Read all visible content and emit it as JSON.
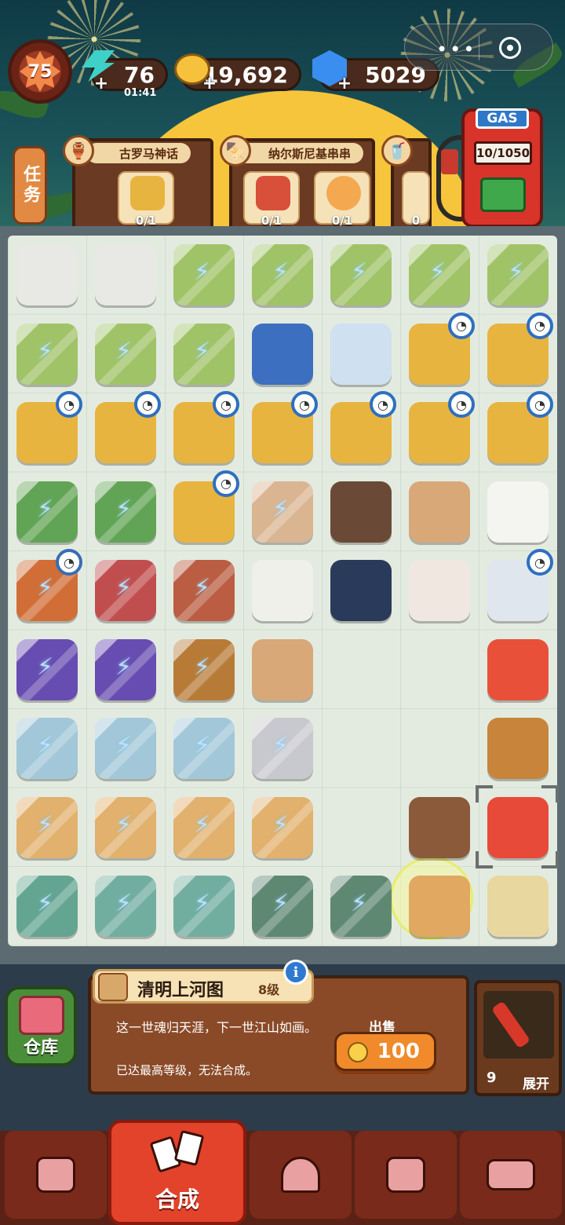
{
  "hud": {
    "level": "75",
    "energy": "76",
    "energy_timer": "01:41",
    "coins": "19,692",
    "gems": "5029"
  },
  "quests": {
    "tab_label": "任务",
    "cards": [
      {
        "title": "古罗马神话",
        "slots": [
          {
            "count": "0/1"
          }
        ]
      },
      {
        "title": "纳尔斯尼基串串",
        "slots": [
          {
            "count": "0/1"
          },
          {
            "count": "0/1"
          }
        ]
      },
      {
        "title": "",
        "slots": [
          {
            "count": "0"
          }
        ]
      }
    ]
  },
  "gas_station": {
    "label": "GAS",
    "fuel": "10/1050"
  },
  "board": {
    "rows": [
      [
        {
          "icon": "printer-icon",
          "color": "#e8e8e4",
          "locked": false
        },
        {
          "icon": "printer-icon",
          "color": "#e8e8e4",
          "locked": false
        },
        {
          "icon": "bamboo-pot-icon",
          "color": "#9cc65a",
          "locked": true
        },
        {
          "icon": "bamboo-pot-icon",
          "color": "#9cc65a",
          "locked": true
        },
        {
          "icon": "bamboo-pot-icon",
          "color": "#9cc65a",
          "locked": true
        },
        {
          "icon": "bamboo-pot-icon",
          "color": "#9cc65a",
          "locked": true
        },
        {
          "icon": "bamboo-pot-icon",
          "color": "#9cc65a",
          "locked": true
        }
      ],
      [
        {
          "icon": "bamboo-pot-icon",
          "color": "#9cc65a",
          "locked": true
        },
        {
          "icon": "bamboo-pot-icon",
          "color": "#9cc65a",
          "locked": true
        },
        {
          "icon": "bamboo-pot-icon",
          "color": "#9cc65a",
          "locked": true
        },
        {
          "icon": "book-icon",
          "color": "#3c6fc0",
          "locked": false
        },
        {
          "icon": "notebook-icon",
          "color": "#cfe0f0",
          "locked": false
        },
        {
          "icon": "drone-box-icon",
          "color": "#e8b440",
          "locked": false,
          "timer": true
        },
        {
          "icon": "drone-box-icon",
          "color": "#e8b440",
          "locked": false,
          "timer": true
        }
      ],
      [
        {
          "icon": "drone-box-icon",
          "color": "#e8b440",
          "locked": false,
          "timer": true
        },
        {
          "icon": "drone-box-icon",
          "color": "#e8b440",
          "locked": false,
          "timer": true
        },
        {
          "icon": "drone-box-icon",
          "color": "#e8b440",
          "locked": false,
          "timer": true
        },
        {
          "icon": "drone-box-icon",
          "color": "#e8b440",
          "locked": false,
          "timer": true
        },
        {
          "icon": "drone-box-icon",
          "color": "#e8b440",
          "locked": false,
          "timer": true
        },
        {
          "icon": "drone-box-icon",
          "color": "#e8b440",
          "locked": false,
          "timer": true
        },
        {
          "icon": "drone-box-icon",
          "color": "#e8b440",
          "locked": false,
          "timer": true
        }
      ],
      [
        {
          "icon": "tree-icon",
          "color": "#5aa84a",
          "locked": true
        },
        {
          "icon": "tree-icon",
          "color": "#5aa84a",
          "locked": true
        },
        {
          "icon": "drone-box-icon",
          "color": "#e8b440",
          "locked": false,
          "timer": true
        },
        {
          "icon": "cart-icon",
          "color": "#e0b48a",
          "locked": true
        },
        {
          "icon": "tray-icon",
          "color": "#6a4a36",
          "locked": false
        },
        {
          "icon": "wood-piece-icon",
          "color": "#d8a878",
          "locked": false
        },
        {
          "icon": "sugar-cubes-icon",
          "color": "#f4f4f0",
          "locked": false
        }
      ],
      [
        {
          "icon": "peacock-feather-icon",
          "color": "#e06a2a",
          "locked": true,
          "timer": true
        },
        {
          "icon": "rose-vase-icon",
          "color": "#d04a4a",
          "locked": true
        },
        {
          "icon": "gift-bag-icon",
          "color": "#c85a3a",
          "locked": true
        },
        {
          "icon": "calendar-icon",
          "color": "#f0f0ea",
          "locked": false
        },
        {
          "icon": "ink-bottle-icon",
          "color": "#2a3a5a",
          "locked": false
        },
        {
          "icon": "color-ink-box-icon",
          "color": "#f0e8e0",
          "locked": false
        },
        {
          "icon": "ink-jar-icon",
          "color": "#e0e6ee",
          "locked": false,
          "timer": true
        }
      ],
      [
        {
          "icon": "wizard-hat-icon",
          "color": "#6a4ac0",
          "locked": true
        },
        {
          "icon": "wizard-hat-icon",
          "color": "#6a4ac0",
          "locked": true
        },
        {
          "icon": "brass-machine-icon",
          "color": "#c07a2a",
          "locked": true
        },
        {
          "icon": "wood-piece-icon",
          "color": "#d8a878",
          "locked": false
        },
        {
          "icon": "",
          "color": "",
          "locked": false
        },
        {
          "icon": "",
          "color": "",
          "locked": false
        },
        {
          "icon": "triangle-candy-icon",
          "color": "#e8503a",
          "locked": false
        }
      ],
      [
        {
          "icon": "locker-icon",
          "color": "#9cc8dc",
          "locked": true
        },
        {
          "icon": "cabinet-icon",
          "color": "#9cc8dc",
          "locked": true
        },
        {
          "icon": "cabinet-icon",
          "color": "#9cc8dc",
          "locked": true
        },
        {
          "icon": "safe-icon",
          "color": "#c8c8d0",
          "locked": true
        },
        {
          "icon": "",
          "color": "",
          "locked": false
        },
        {
          "icon": "",
          "color": "",
          "locked": false
        },
        {
          "icon": "bubble-tea-icon",
          "color": "#c8843a",
          "locked": false
        }
      ],
      [
        {
          "icon": "frame-icon",
          "color": "#e8b060",
          "locked": true
        },
        {
          "icon": "shelf-cart-icon",
          "color": "#e8b060",
          "locked": true
        },
        {
          "icon": "shelf-cart-icon",
          "color": "#e8b060",
          "locked": true
        },
        {
          "icon": "bottle-shelf-icon",
          "color": "#e8b060",
          "locked": true
        },
        {
          "icon": "",
          "color": "",
          "locked": false
        },
        {
          "icon": "bubble-tea-icon",
          "color": "#8a5a3a",
          "locked": false
        },
        {
          "icon": "scroll-icon",
          "color": "#e84a3a",
          "locked": false,
          "focus": true
        }
      ],
      [
        {
          "icon": "hotpot-cooker-icon",
          "color": "#5aa890",
          "locked": true
        },
        {
          "icon": "hotpot-cooker-icon",
          "color": "#6ab0a0",
          "locked": true
        },
        {
          "icon": "hotpot-cooker-icon",
          "color": "#6ab0a0",
          "locked": true
        },
        {
          "icon": "hotpot-icon",
          "color": "#5a8a70",
          "locked": true
        },
        {
          "icon": "hotpot-icon",
          "color": "#5a8a70",
          "locked": true
        },
        {
          "icon": "pyramid-icon",
          "color": "#e0a860",
          "locked": false,
          "selected": true
        },
        {
          "icon": "key-plate-icon",
          "color": "#e8d8a0",
          "locked": false
        }
      ]
    ]
  },
  "info_panel": {
    "storage_label": "仓库",
    "item_name": "清明上河图",
    "item_level": "8级",
    "description": "这一世魂归天涯，下一世江山如画。",
    "max_level_note": "已达最高等级，无法合成。",
    "sell_label": "出售",
    "sell_price": "100",
    "expand_count": "9",
    "expand_label": "展开"
  },
  "nav": {
    "merge_label": "合成",
    "items": [
      "shop-bag-icon",
      "merge-cards-icon",
      "service-bell-icon",
      "map-pin-icon",
      "bus-icon"
    ]
  },
  "colors": {
    "accent_red": "#e2432a",
    "sell_orange": "#f08a2a",
    "board_bg": "#e3ebe0"
  }
}
